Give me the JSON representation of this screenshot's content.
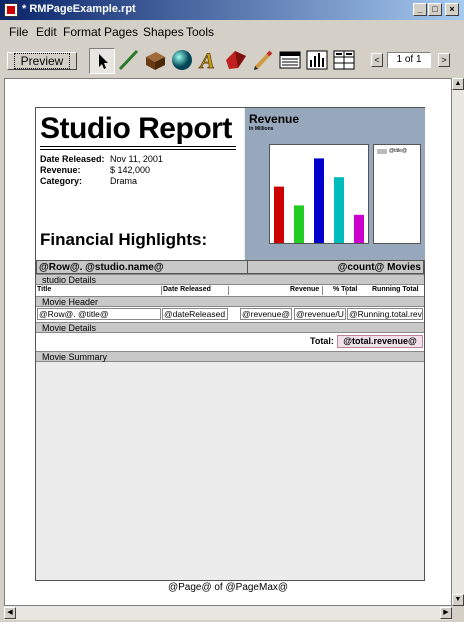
{
  "window": {
    "title": "* RMPageExample.rpt",
    "minimize": "_",
    "maximize": "□",
    "close": "×"
  },
  "menu": [
    "File",
    "Edit",
    "Format",
    "Pages",
    "Shapes",
    "Tools"
  ],
  "toolbar": {
    "preview_label": "Preview",
    "tools": [
      "arrow-tool-icon",
      "line-tool-icon",
      "box-tool-icon",
      "oval-tool-icon",
      "text-tool-icon",
      "polygon-tool-icon",
      "pencil-tool-icon",
      "table-tool-icon",
      "graph-tool-icon",
      "crosstab-tool-icon"
    ],
    "page_field": "1 of 1",
    "prev": "<",
    "next": ">"
  },
  "report": {
    "title": "Studio Report",
    "date_label": "Date Released:",
    "date_value": "Nov 11, 2001",
    "revenue_label": "Revenue:",
    "revenue_value": "$ 142,000",
    "category_label": "Category:",
    "category_value": "Drama",
    "financial_title": "Financial Highlights:",
    "revenue_panel_title": "Revenue",
    "revenue_panel_subtitle": "In Millions",
    "legend_text": "@title@",
    "group_header_left": "@Row@. @studio.name@",
    "group_header_right": "@count@ Movies",
    "studio_details": "studio Details",
    "columns": [
      "Title",
      "Date Released",
      "Revenue",
      "% Total",
      "Running Total"
    ],
    "movie_header": "Movie Header",
    "detail_cells": [
      "@Row@. @title@",
      "@dateReleased",
      "@revenue@",
      "@revenue/U",
      "@Running.total.rev"
    ],
    "movie_details": "Movie Details",
    "total_label": "Total:",
    "total_value": "@total.revenue@",
    "movie_summary": "Movie Summary",
    "page_footer": "@Page@ of @PageMax@"
  },
  "colors": {
    "bar_colors": [
      "#cc0000",
      "#22cc22",
      "#0000cc",
      "#00bbbb",
      "#cc00cc"
    ]
  },
  "chart_data": {
    "type": "bar",
    "title": "Revenue",
    "subtitle": "In Millions",
    "categories": [
      "",
      "",
      "",
      "",
      ""
    ],
    "values": [
      60,
      40,
      90,
      70,
      30
    ],
    "ylim": [
      0,
      100
    ],
    "legend": [
      "@title@"
    ]
  }
}
